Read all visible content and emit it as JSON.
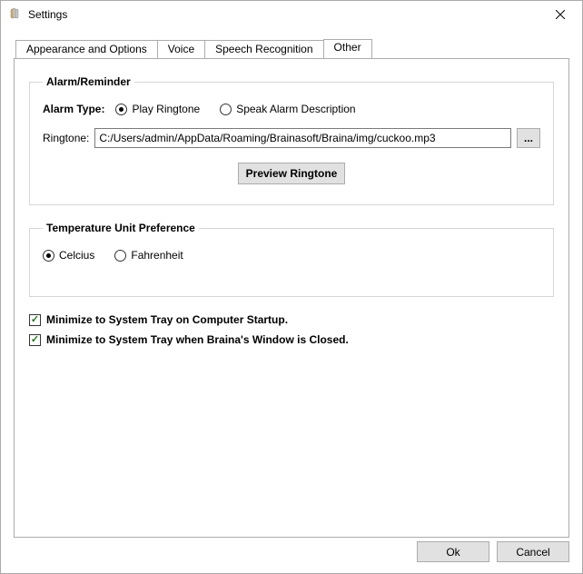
{
  "window": {
    "title": "Settings"
  },
  "tabs": {
    "appearance": "Appearance and Options",
    "voice": "Voice",
    "speech": "Speech Recognition",
    "other": "Other"
  },
  "alarm": {
    "legend": "Alarm/Reminder",
    "type_label": "Alarm Type:",
    "play_ringtone": "Play Ringtone",
    "speak_desc": "Speak Alarm Description",
    "ringtone_label": "Ringtone:",
    "ringtone_path": "C:/Users/admin/AppData/Roaming/Brainasoft/Braina/img/cuckoo.mp3",
    "browse": "...",
    "preview": "Preview Ringtone"
  },
  "temp": {
    "legend": "Temperature Unit Preference",
    "celcius": "Celcius",
    "fahrenheit": "Fahrenheit"
  },
  "checks": {
    "startup": "Minimize to System Tray on Computer Startup.",
    "closed": "Minimize to System Tray when Braina's Window is Closed."
  },
  "footer": {
    "ok": "Ok",
    "cancel": "Cancel"
  }
}
